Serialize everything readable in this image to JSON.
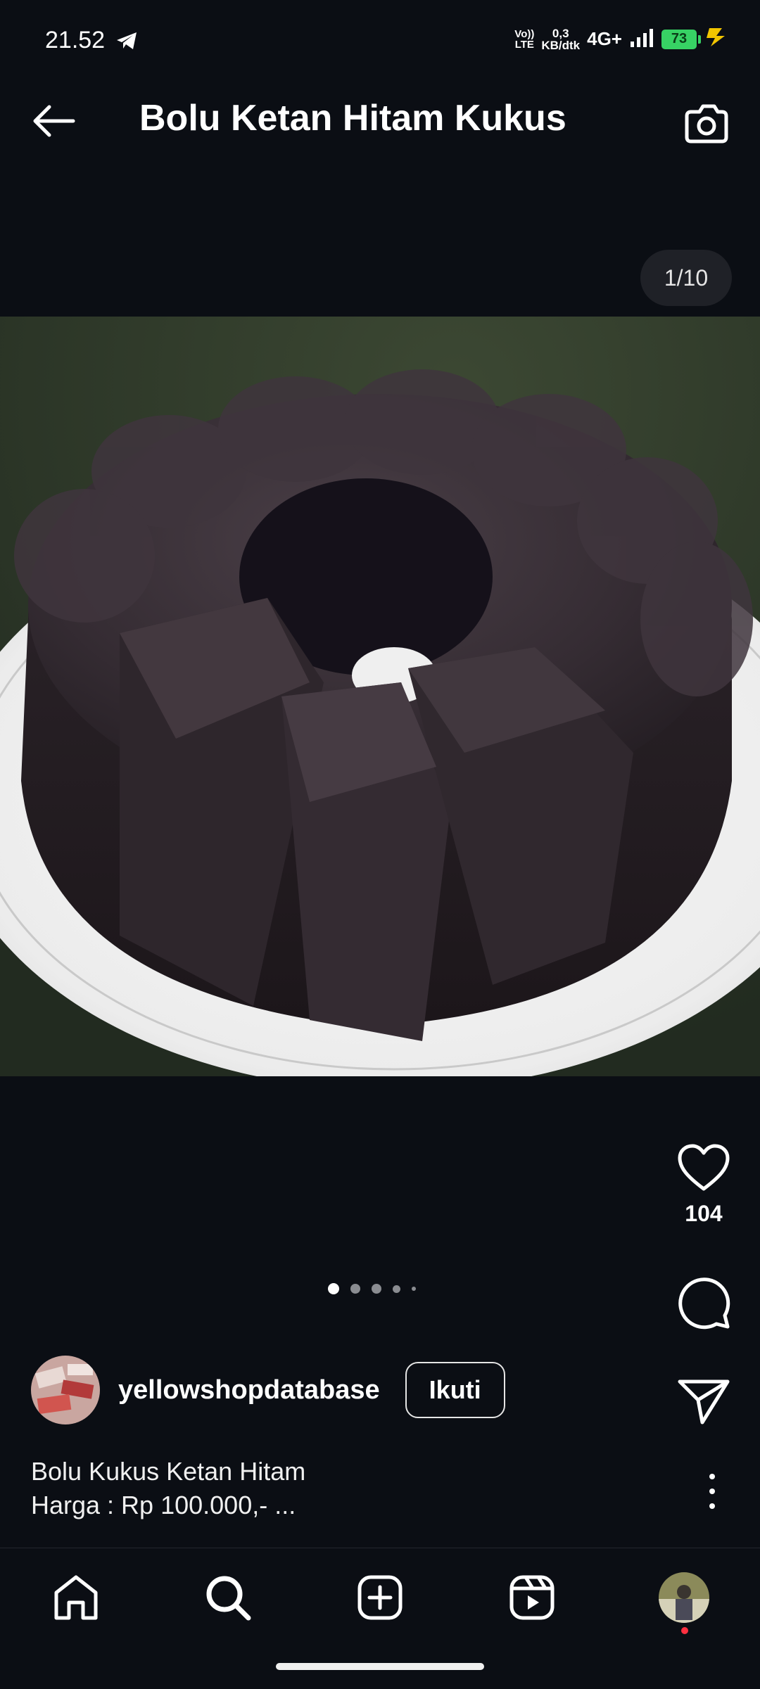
{
  "status_bar": {
    "time": "21.52",
    "volte": [
      "Vo))",
      "LTE"
    ],
    "speed": [
      "0,3",
      "KB/dtk"
    ],
    "network": "4G+",
    "battery": "73"
  },
  "header": {
    "title": "Bolu Ketan Hitam Kukus",
    "back_icon": "arrow-left-icon",
    "camera_icon": "camera-icon"
  },
  "media": {
    "counter": "1/10",
    "description": "round dark purple black sticky rice bundt cake on white plate"
  },
  "actions": {
    "like_count": "104",
    "icons": [
      "heart-icon",
      "comment-icon",
      "share-icon"
    ]
  },
  "pager": {
    "active_index": 0,
    "visible_dots": 5
  },
  "author": {
    "username": "yellowshopdatabase",
    "follow_label": "Ikuti"
  },
  "caption": {
    "line1": "Bolu Kukus Ketan Hitam",
    "line2": "Harga : Rp 100.000,- ..."
  },
  "bottom_nav": {
    "items": [
      "home-icon",
      "search-icon",
      "create-icon",
      "reels-icon",
      "profile-avatar"
    ]
  },
  "colors": {
    "background": "#0b0e14",
    "badge_bg": "#1f2127",
    "notification_dot": "#ff3040",
    "battery": "#37d264"
  }
}
